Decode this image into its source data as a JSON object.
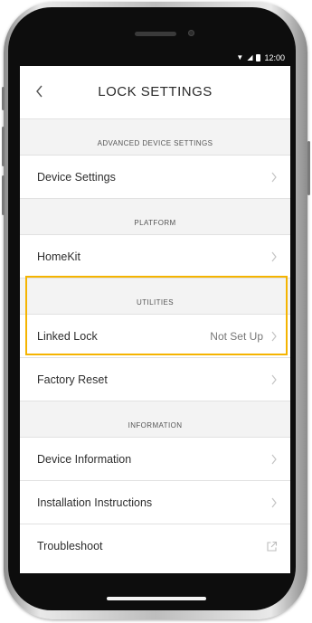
{
  "status_bar": {
    "time": "12:00",
    "wifi_icon": "wifi-icon",
    "signal_icon": "signal-icon",
    "battery_icon": "battery-icon"
  },
  "header": {
    "title": "LOCK SETTINGS",
    "back_icon": "chevron-left-icon"
  },
  "sections": {
    "advanced": {
      "header": "ADVANCED DEVICE SETTINGS",
      "rows": [
        {
          "label": "Device Settings"
        }
      ]
    },
    "platform": {
      "header": "PLATFORM",
      "rows": [
        {
          "label": "HomeKit"
        }
      ]
    },
    "utilities": {
      "header": "UTILITIES",
      "rows": [
        {
          "label": "Linked Lock",
          "value": "Not Set Up"
        },
        {
          "label": "Factory Reset"
        }
      ]
    },
    "information": {
      "header": "INFORMATION",
      "rows": [
        {
          "label": "Device Information"
        },
        {
          "label": "Installation Instructions"
        },
        {
          "label": "Troubleshoot",
          "icon": "external-link-icon"
        }
      ]
    }
  },
  "colors": {
    "highlight": "#f5b400",
    "section_bg": "#f3f3f3",
    "text": "#2e2e2e",
    "chevron": "#c4c4c4"
  }
}
